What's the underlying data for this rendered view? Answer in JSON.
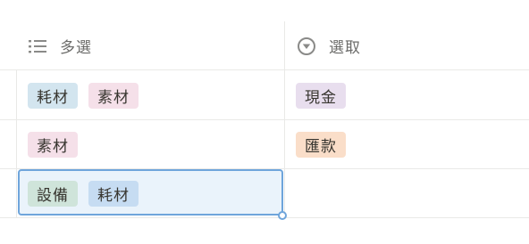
{
  "columns": [
    {
      "label": "多選",
      "icon": "list-icon"
    },
    {
      "label": "選取",
      "icon": "select-dropdown-icon"
    }
  ],
  "rows": [
    {
      "multi": [
        {
          "text": "耗材",
          "color": "#d3e5ef"
        },
        {
          "text": "素材",
          "color": "#f5e0e9"
        }
      ],
      "select": [
        {
          "text": "現金",
          "color": "#e8deee"
        }
      ]
    },
    {
      "multi": [
        {
          "text": "素材",
          "color": "#f5e0e9"
        }
      ],
      "select": [
        {
          "text": "匯款",
          "color": "#fadec9"
        }
      ]
    },
    {
      "multi": [
        {
          "text": "設備",
          "color": "#cfe4da"
        },
        {
          "text": "耗材",
          "color": "#c6dcf2"
        }
      ],
      "select": []
    }
  ],
  "selected_cell": {
    "row": 3,
    "column": "多選"
  }
}
